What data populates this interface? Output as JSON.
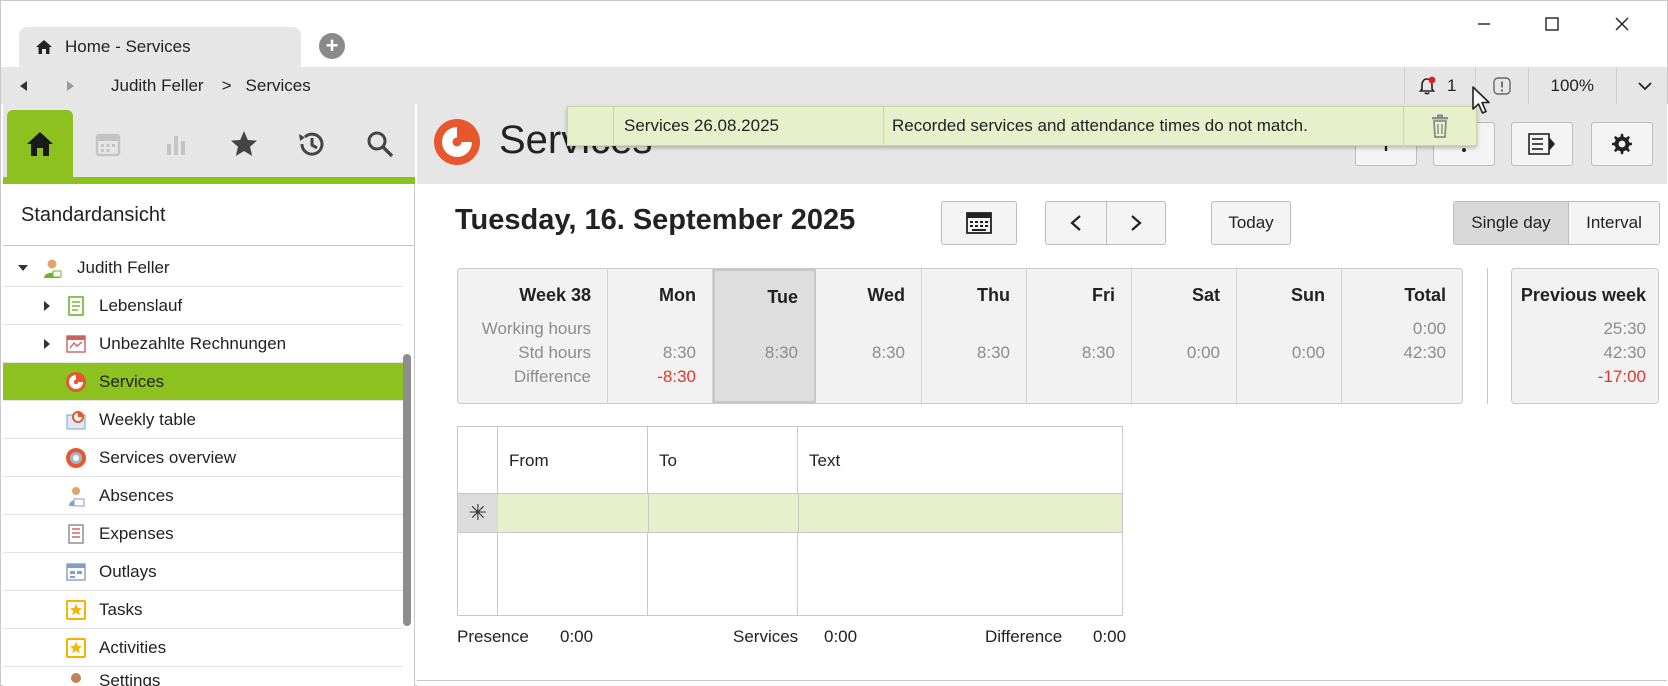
{
  "tab": {
    "title": "Home - Services",
    "icon": "home-icon"
  },
  "window_controls": [
    "minimize-icon",
    "maximize-icon",
    "close-icon"
  ],
  "breadcrumb": {
    "items": [
      "Judith Feller",
      "Services"
    ],
    "separator": ">"
  },
  "toolbar": {
    "notification_count": "1",
    "zoom": "100%"
  },
  "sidebar": {
    "tabs": [
      "home-icon",
      "calendar-icon",
      "chart-icon",
      "star-icon",
      "history-icon",
      "search-icon"
    ],
    "view_title": "Standardansicht",
    "tree": {
      "root": "Judith Feller",
      "items": [
        {
          "label": "Lebenslauf",
          "icon": "document-icon",
          "expandable": true
        },
        {
          "label": "Unbezahlte Rechnungen",
          "icon": "invoice-icon",
          "expandable": true
        },
        {
          "label": "Services",
          "icon": "services-icon",
          "selected": true
        },
        {
          "label": "Weekly table",
          "icon": "weekly-table-icon"
        },
        {
          "label": "Services overview",
          "icon": "services-overview-icon"
        },
        {
          "label": "Absences",
          "icon": "absences-icon"
        },
        {
          "label": "Expenses",
          "icon": "expenses-icon"
        },
        {
          "label": "Outlays",
          "icon": "outlays-icon"
        },
        {
          "label": "Tasks",
          "icon": "task-icon"
        },
        {
          "label": "Activities",
          "icon": "activity-icon"
        },
        {
          "label": "Settings",
          "icon": "settings-person-icon"
        }
      ]
    }
  },
  "main": {
    "title": "Services",
    "notification": {
      "date": "Services 26.08.2025",
      "message": "Recorded services and attendance times do not match."
    },
    "date_title": "Tuesday, 16. September 2025",
    "buttons": {
      "today": "Today",
      "single_day": "Single day",
      "interval": "Interval"
    },
    "week": {
      "label": "Week  38",
      "row_labels": [
        "Working hours",
        "Std hours",
        "Difference"
      ],
      "days": [
        {
          "name": "Mon",
          "std": "8:30",
          "diff": "-8:30"
        },
        {
          "name": "Tue",
          "std": "8:30"
        },
        {
          "name": "Wed",
          "std": "8:30"
        },
        {
          "name": "Thu",
          "std": "8:30"
        },
        {
          "name": "Fri",
          "std": "8:30"
        },
        {
          "name": "Sat",
          "std": "0:00"
        },
        {
          "name": "Sun",
          "std": "0:00"
        }
      ],
      "total": {
        "name": "Total",
        "working": "0:00",
        "std": "42:30"
      },
      "previous": {
        "name": "Previous week",
        "working": "25:30",
        "std": "42:30",
        "diff": "-17:00"
      }
    },
    "grid": {
      "columns": [
        "From",
        "To",
        "Text"
      ],
      "new_row_symbol": "✳"
    },
    "totals": {
      "presence_label": "Presence",
      "presence_value": "0:00",
      "services_label": "Services",
      "services_value": "0:00",
      "difference_label": "Difference",
      "difference_value": "0:00"
    }
  },
  "colors": {
    "accent": "#8dc11f",
    "negative": "#e0362c",
    "logo": "#e8562e",
    "notification_bg": "#e7efcb"
  }
}
